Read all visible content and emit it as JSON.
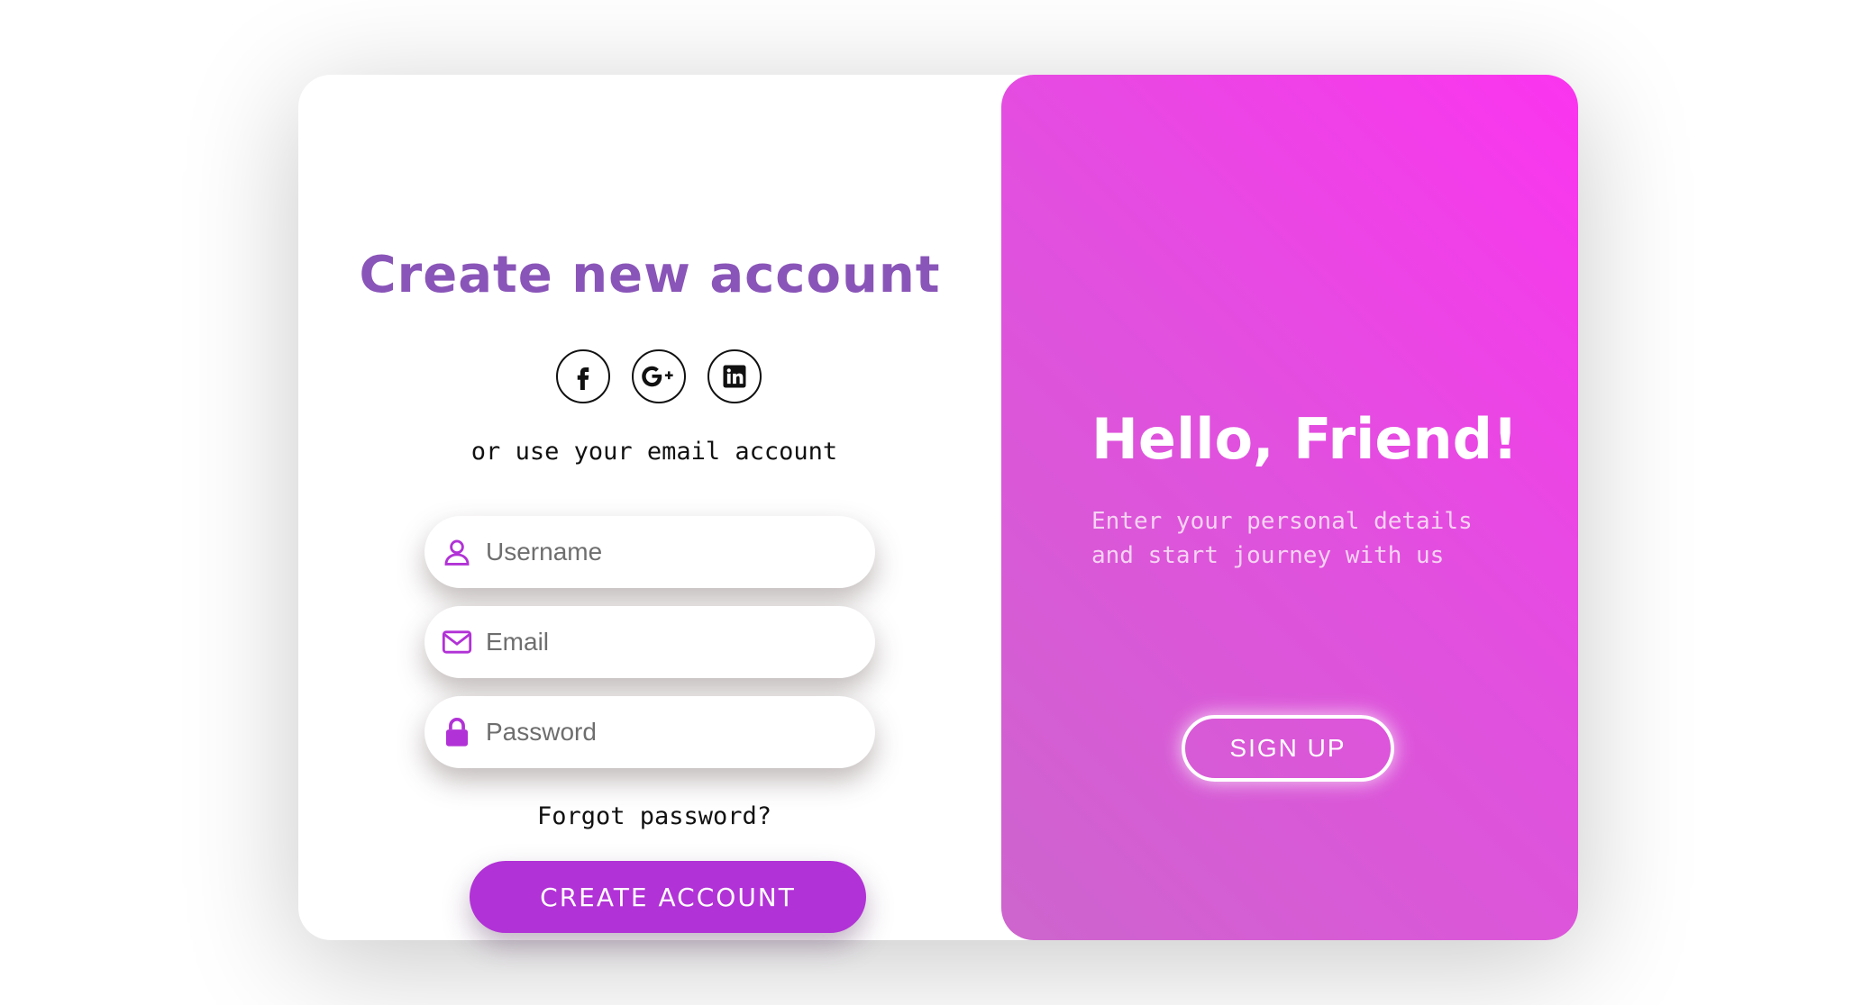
{
  "left": {
    "title": "Create new account",
    "social": [
      "facebook-icon",
      "google-plus-icon",
      "linkedin-icon"
    ],
    "alt_text": "or use your email account",
    "fields": {
      "username": {
        "placeholder": "Username",
        "value": "",
        "icon": "user-icon"
      },
      "email": {
        "placeholder": "Email",
        "value": "",
        "icon": "mail-icon"
      },
      "password": {
        "placeholder": "Password",
        "value": "",
        "icon": "lock-icon"
      }
    },
    "forgot_label": "Forgot password?",
    "create_label": "CREATE ACCOUNT"
  },
  "right": {
    "title": "Hello, Friend!",
    "subtitle": "Enter your personal details and start journey with us",
    "signup_label": "SIGN UP"
  },
  "colors": {
    "accent": "#b132d6",
    "title": "#8a55b8",
    "gradient_start": "#fb34ef",
    "gradient_end": "#cd65cd"
  }
}
